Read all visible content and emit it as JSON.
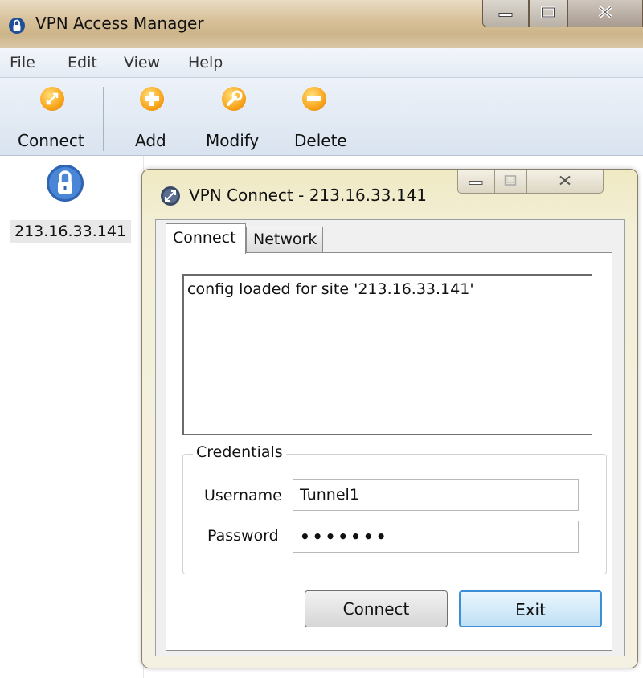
{
  "window": {
    "title": "VPN Access Manager",
    "icon": "padlock-icon"
  },
  "menu": {
    "items": [
      "File",
      "Edit",
      "View",
      "Help"
    ]
  },
  "toolbar": {
    "buttons": [
      {
        "label": "Connect",
        "icon": "connect-icon"
      },
      {
        "label": "Add",
        "icon": "add-icon"
      },
      {
        "label": "Modify",
        "icon": "wrench-icon"
      },
      {
        "label": "Delete",
        "icon": "delete-icon"
      }
    ]
  },
  "sites": {
    "items": [
      {
        "label": "213.16.33.141",
        "icon": "padlock-icon"
      }
    ]
  },
  "dialog": {
    "title": "VPN Connect - 213.16.33.141",
    "tabs": [
      "Connect",
      "Network"
    ],
    "active_tab": "Connect",
    "log": [
      "config loaded for site '213.16.33.141'"
    ],
    "credentials": {
      "legend": "Credentials",
      "username_label": "Username",
      "username_value": "Tunnel1",
      "password_label": "Password",
      "password_value": "•••••••"
    },
    "connect_label": "Connect",
    "exit_label": "Exit"
  },
  "colors": {
    "toolbar_icon": "#f9a51b",
    "site_icon": "#2f64b3",
    "exit_focus": "#3c8fd6"
  }
}
